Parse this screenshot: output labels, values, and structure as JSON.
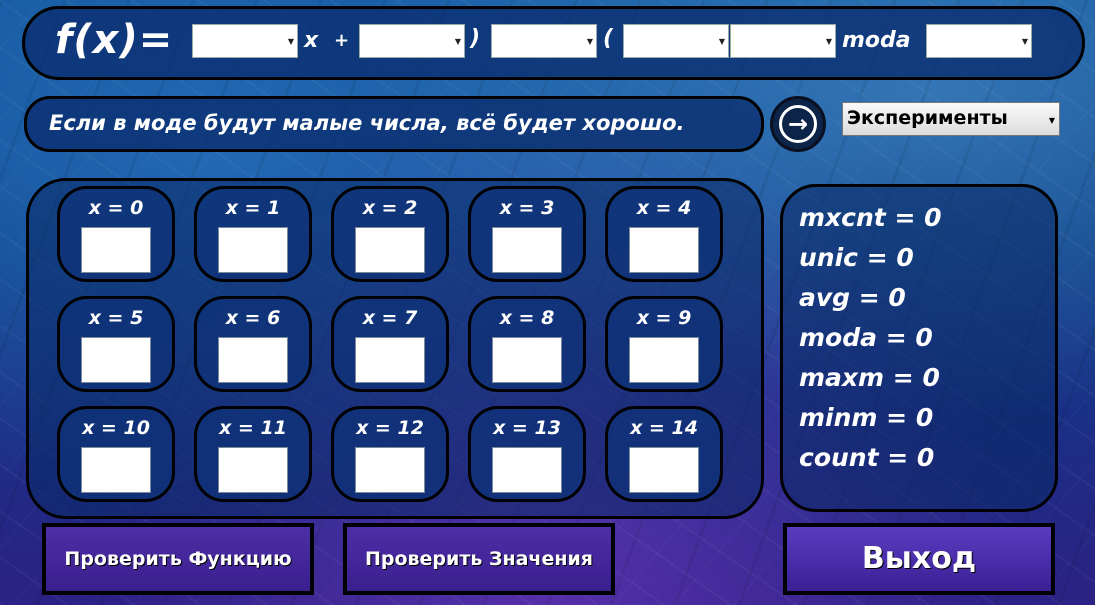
{
  "formula": {
    "fx_label": "f(x)=",
    "x_symbol": "x",
    "plus_symbol": "+",
    "close_paren": ")",
    "open_paren": "(",
    "moda_label": "moda",
    "combos": [
      "",
      "",
      "",
      "",
      "",
      ""
    ]
  },
  "message": {
    "text": "Если в моде будут малые числа, всё будет хорошо."
  },
  "experiments": {
    "selected": "Эксперименты"
  },
  "grid": {
    "cells": [
      {
        "label": "x = 0",
        "value": ""
      },
      {
        "label": "x = 1",
        "value": ""
      },
      {
        "label": "x = 2",
        "value": ""
      },
      {
        "label": "x = 3",
        "value": ""
      },
      {
        "label": "x = 4",
        "value": ""
      },
      {
        "label": "x = 5",
        "value": ""
      },
      {
        "label": "x = 6",
        "value": ""
      },
      {
        "label": "x = 7",
        "value": ""
      },
      {
        "label": "x = 8",
        "value": ""
      },
      {
        "label": "x = 9",
        "value": ""
      },
      {
        "label": "x = 10",
        "value": ""
      },
      {
        "label": "x = 11",
        "value": ""
      },
      {
        "label": "x = 12",
        "value": ""
      },
      {
        "label": "x = 13",
        "value": ""
      },
      {
        "label": "x = 14",
        "value": ""
      }
    ]
  },
  "stats": {
    "mxcnt": "mxcnt = 0",
    "unic": "unic = 0",
    "avg": "avg = 0",
    "moda": "moda = 0",
    "maxm": "maxm = 0",
    "minm": "minm = 0",
    "count": "count = 0"
  },
  "buttons": {
    "check_function": "Проверить Функцию",
    "check_values": "Проверить Значения",
    "exit": "Выход"
  },
  "icons": {
    "next": "arrow-right-circle-icon",
    "dropdown": "dropdown-arrow-icon"
  }
}
